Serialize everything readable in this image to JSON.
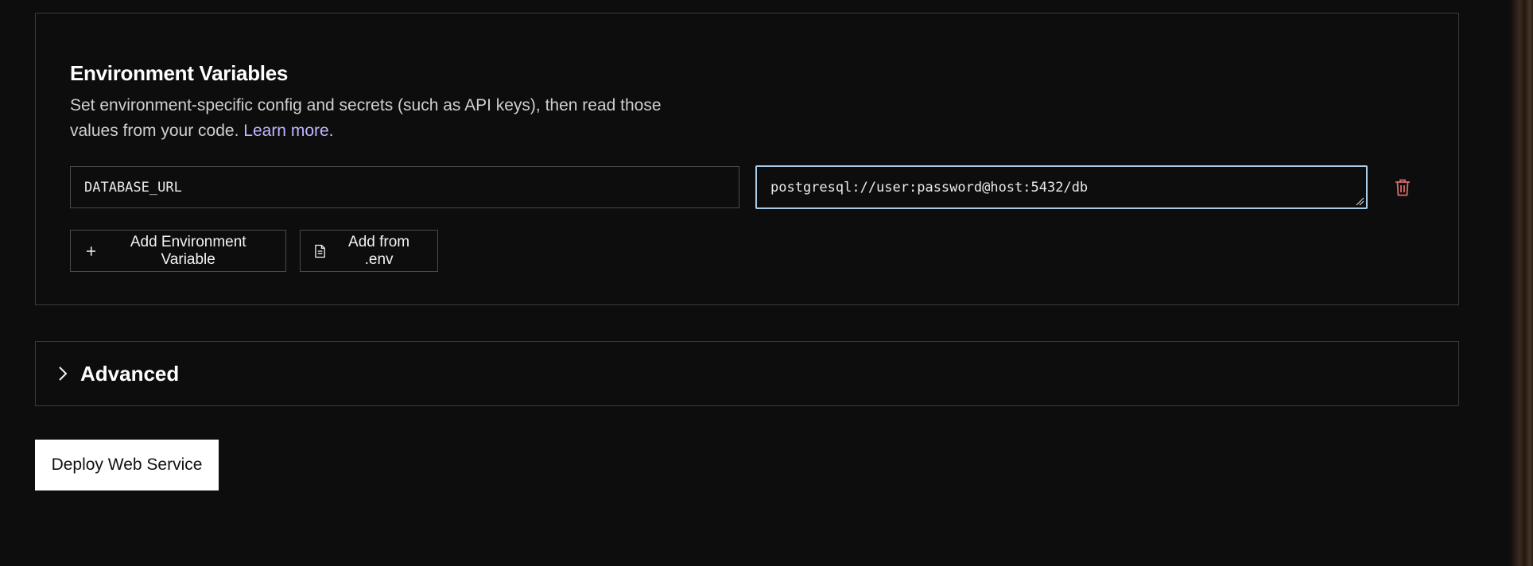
{
  "env_vars": {
    "title": "Environment Variables",
    "description": "Set environment-specific config and secrets (such as API keys), then read those values from your code.",
    "learn_more_label": "Learn more",
    "description_suffix": ".",
    "rows": [
      {
        "key": "DATABASE_URL",
        "value": "postgresql://user:password@host:5432/db"
      }
    ],
    "add_variable_label": "Add Environment Variable",
    "add_from_env_label": "Add from .env",
    "delete_icon": "trash-icon",
    "delete_color": "#d96a6a"
  },
  "advanced": {
    "title": "Advanced",
    "icon": "chevron-right-icon"
  },
  "deploy_button_label": "Deploy Web Service",
  "colors": {
    "background": "#0d0d0d",
    "link": "#c4b2ff",
    "focus_border": "#a7cde8",
    "border": "#3a3a3a"
  }
}
